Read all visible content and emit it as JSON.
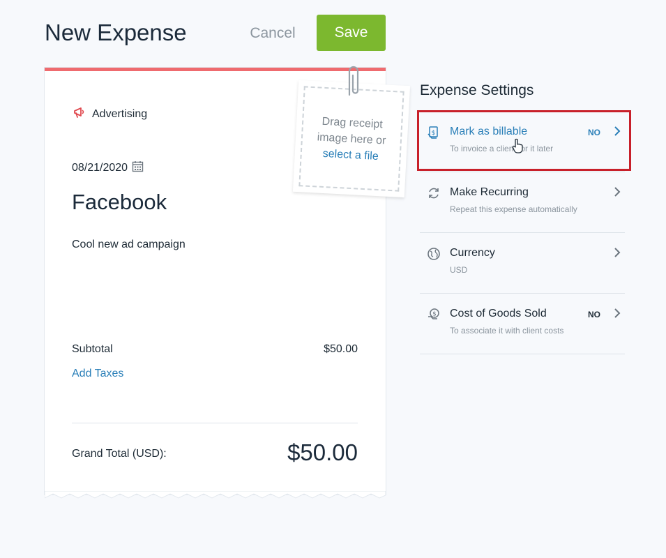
{
  "header": {
    "title": "New Expense",
    "cancel_label": "Cancel",
    "save_label": "Save"
  },
  "expense": {
    "category": "Advertising",
    "category_icon": "megaphone-icon",
    "date": "08/21/2020",
    "vendor": "Facebook",
    "description": "Cool new ad campaign",
    "subtotal_label": "Subtotal",
    "subtotal_value": "$50.00",
    "add_taxes_label": "Add Taxes",
    "grand_total_label": "Grand Total (USD):",
    "grand_total_value": "$50.00"
  },
  "receipt": {
    "line1": "Drag receipt",
    "line2": "image here or",
    "link": "select a file"
  },
  "settings": {
    "title": "Expense Settings",
    "items": [
      {
        "title": "Mark as billable",
        "subtitle": "To invoice a client for it later",
        "badge": "NO",
        "icon": "billable-icon"
      },
      {
        "title": "Make Recurring",
        "subtitle": "Repeat this expense automatically",
        "badge": "",
        "icon": "recurring-icon"
      },
      {
        "title": "Currency",
        "subtitle": "USD",
        "badge": "",
        "icon": "globe-icon"
      },
      {
        "title": "Cost of Goods Sold",
        "subtitle": "To associate it with client costs",
        "badge": "NO",
        "icon": "cost-of-goods-icon"
      }
    ]
  },
  "colors": {
    "accent_green": "#7cb82f",
    "link_blue": "#2a7fb8",
    "card_top_red": "#ef6b6f",
    "highlight_red": "#c8202a"
  }
}
